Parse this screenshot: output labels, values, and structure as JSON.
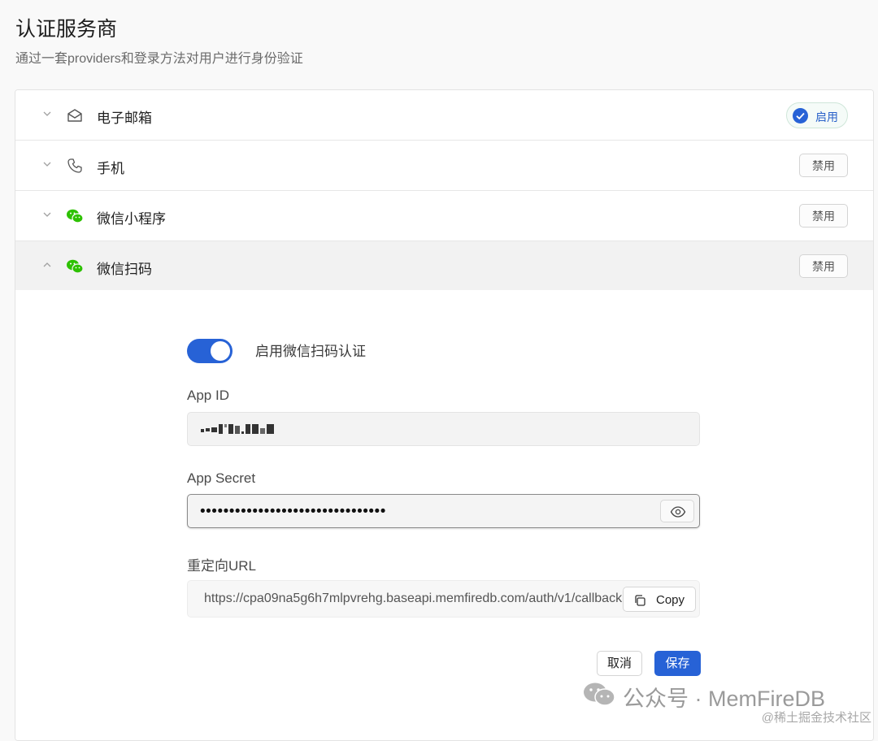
{
  "header": {
    "title": "认证服务商",
    "subtitle": "通过一套providers和登录方法对用户进行身份验证"
  },
  "providers": [
    {
      "label": "电子邮箱",
      "icon": "mail-icon",
      "status": "启用",
      "enabled": true
    },
    {
      "label": "手机",
      "icon": "phone-icon",
      "status": "禁用",
      "enabled": false
    },
    {
      "label": "微信小程序",
      "icon": "wechat-icon",
      "status": "禁用",
      "enabled": false
    },
    {
      "label": "微信扫码",
      "icon": "wechat-icon",
      "status": "禁用",
      "enabled": false,
      "expanded": true
    }
  ],
  "wechat_form": {
    "toggle_label": "启用微信扫码认证",
    "toggle_on": true,
    "app_id_label": "App ID",
    "app_secret_label": "App Secret",
    "app_secret_value": "••••••••••••••••••••••••••••••••",
    "redirect_label": "重定向URL",
    "redirect_value": "https://cpa09na5g6h7mlpvrehg.baseapi.memfiredb.com/auth/v1/callback",
    "copy_label": "Copy",
    "cancel_label": "取消",
    "save_label": "保存"
  },
  "colors": {
    "accent": "#2762d6",
    "wechat_green": "#2dc100"
  },
  "watermark": {
    "text": "公众号 · MemFireDB",
    "sub": "@稀土掘金技术社区"
  }
}
